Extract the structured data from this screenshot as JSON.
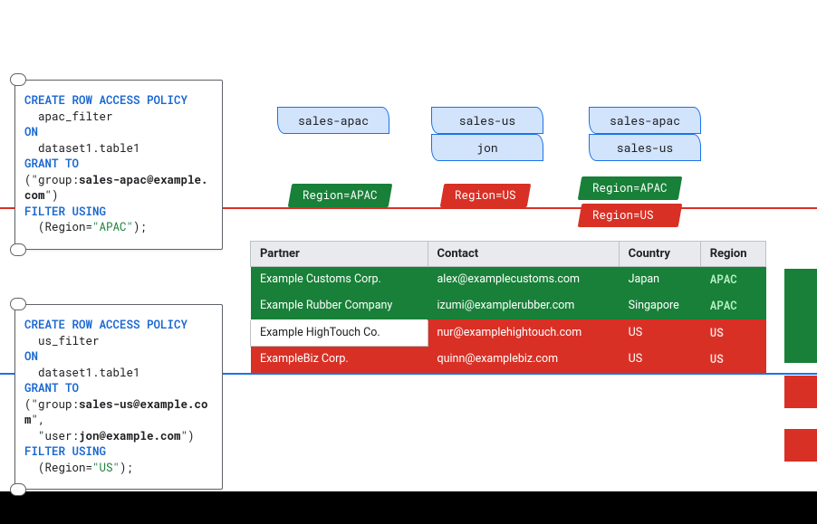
{
  "policy_apac": {
    "kw_create": "CREATE ROW ACCESS POLICY",
    "name": "apac_filter",
    "kw_on": "ON",
    "target": "dataset1.table1",
    "kw_grant": "GRANT TO",
    "principals_prefix": "(\"group:",
    "principals_bold": "sales-apac@example.com",
    "principals_suffix": "\")",
    "kw_filter": "FILTER USING",
    "filter_prefix": "  (Region=",
    "filter_value": "\"APAC\"",
    "filter_suffix": ");"
  },
  "policy_us": {
    "kw_create": "CREATE ROW ACCESS POLICY",
    "name": "us_filter",
    "kw_on": "ON",
    "target": "dataset1.table1",
    "kw_grant": "GRANT TO",
    "principals_prefix": "(\"group:",
    "principals_bold": "sales-us@example.com",
    "line2_prefix": "\",\n  \"user:",
    "principals_bold2": "jon@example.com",
    "principals_suffix": "\")",
    "kw_filter": "FILTER USING",
    "filter_prefix": "  (Region=",
    "filter_value": "\"US\"",
    "filter_suffix": ");"
  },
  "groups": {
    "left": [
      "sales-apac"
    ],
    "center": [
      "sales-us",
      "jon"
    ],
    "right": [
      "sales-apac",
      "sales-us"
    ]
  },
  "filters": {
    "left": [
      "Region=APAC"
    ],
    "center": [
      "Region=US"
    ],
    "right": [
      "Region=APAC",
      "Region=US"
    ]
  },
  "table": {
    "headers": [
      "Partner",
      "Contact",
      "Country",
      "Region"
    ],
    "rows": [
      {
        "class": "row-green",
        "cells": [
          "Example Customs Corp.",
          "alex@examplecustoms.com",
          "Japan",
          "APAC"
        ]
      },
      {
        "class": "row-green",
        "cells": [
          "Example Rubber Company",
          "izumi@examplerubber.com",
          "Singapore",
          "APAC"
        ]
      },
      {
        "class": "row-red",
        "cells": [
          "Example HighTouch Co.",
          "nur@examplehightouch.com",
          "US",
          "US"
        ],
        "whiteFirstCell": true
      },
      {
        "class": "row-red",
        "cells": [
          "ExampleBiz Corp.",
          "quinn@examplebiz.com",
          "US",
          "US"
        ]
      }
    ]
  }
}
